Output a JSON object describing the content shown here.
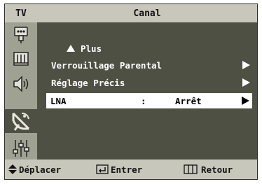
{
  "header": {
    "tv_label": "TV",
    "title": "Canal"
  },
  "sidebar": {
    "icons": [
      {
        "name": "input-icon"
      },
      {
        "name": "picture-icon"
      },
      {
        "name": "sound-icon"
      },
      {
        "name": "channel-antenna-icon",
        "active": true
      },
      {
        "name": "setup-icon"
      }
    ]
  },
  "menu": {
    "more_label": "Plus",
    "items": [
      {
        "label": "Verrouillage Parental"
      },
      {
        "label": "Réglage Précis"
      },
      {
        "label": "LNA",
        "separator": ":",
        "value": "Arrêt"
      }
    ]
  },
  "footer": {
    "move_label": "Déplacer",
    "enter_label": "Entrer",
    "return_label": "Retour"
  },
  "colors": {
    "panel_bg": "#4f5044",
    "bar_bg": "#c7c8bb",
    "sidebar_bg": "#9fa293",
    "highlight_bg": "#ffffff",
    "text_light": "#ffffff"
  }
}
